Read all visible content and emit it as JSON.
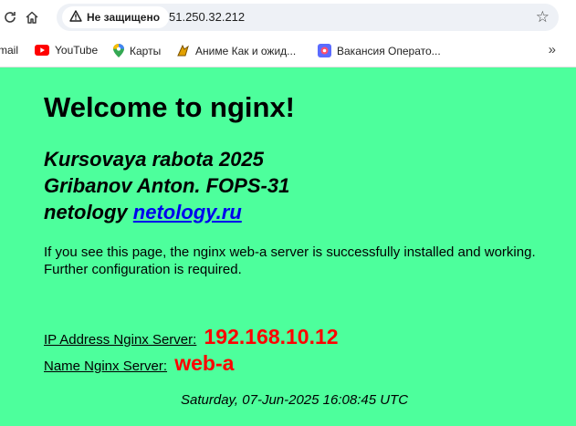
{
  "browser": {
    "security_label": "Не защищено",
    "url": "51.250.32.212",
    "bookmarks": [
      {
        "label": "mail",
        "icon": "mail-icon"
      },
      {
        "label": "YouTube",
        "icon": "youtube-icon"
      },
      {
        "label": "Карты",
        "icon": "maps-pin-icon"
      },
      {
        "label": "Аниме Как и ожид...",
        "icon": "anime-site-icon"
      },
      {
        "label": "Вакансия Операто...",
        "icon": "vacancy-site-icon"
      }
    ]
  },
  "page": {
    "title": "Welcome to nginx!",
    "project_line1": "Kursovaya rabota 2025",
    "project_line2": "Gribanov Anton. FOPS-31",
    "project_line3_prefix": "netology",
    "project_link": "netology.ru",
    "description": "If you see this page, the nginx web-a server is successfully installed and working. Further configuration is required.",
    "ip_label": "IP Address Nginx Server:",
    "ip_value": "192.168.10.12",
    "name_label": "Name Nginx Server:",
    "name_value": "web-a",
    "datetime": "Saturday, 07-Jun-2025 16:08:45 UTC"
  },
  "colors": {
    "page_background": "#4dff9c",
    "value_red": "#ff0000",
    "link_blue": "#0000ee"
  }
}
